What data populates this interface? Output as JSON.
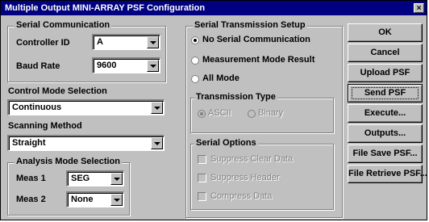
{
  "window": {
    "title": "Multiple Output MINI-ARRAY PSF Configuration",
    "close_glyph": "×"
  },
  "serial_comm": {
    "title": "Serial Communication",
    "controller_id_label": "Controller ID",
    "controller_id_value": "A",
    "baud_rate_label": "Baud Rate",
    "baud_rate_value": "9600"
  },
  "control_mode": {
    "label": "Control Mode Selection",
    "value": "Continuous"
  },
  "scanning": {
    "label": "Scanning Method",
    "value": "Straight"
  },
  "analysis": {
    "title": "Analysis Mode Selection",
    "meas1_label": "Meas 1",
    "meas1_value": "SEG",
    "meas2_label": "Meas 2",
    "meas2_value": "None"
  },
  "serial_tx": {
    "title": "Serial Transmission Setup",
    "options": [
      {
        "label": "No Serial Communication",
        "selected": true
      },
      {
        "label": "Measurement Mode Result",
        "selected": false
      },
      {
        "label": "All Mode",
        "selected": false
      }
    ]
  },
  "tx_type": {
    "title": "Transmission Type",
    "options": [
      {
        "label": "ASCII",
        "selected": true
      },
      {
        "label": "Binary",
        "selected": false
      }
    ]
  },
  "serial_options": {
    "title": "Serial Options",
    "items": [
      {
        "label": "Suppress Clear Data"
      },
      {
        "label": "Suppress Header"
      },
      {
        "label": "Compress Data"
      }
    ]
  },
  "buttons": {
    "ok": "OK",
    "cancel": "Cancel",
    "upload": "Upload PSF",
    "send": "Send PSF",
    "execute": "Execute...",
    "outputs": "Outputs...",
    "file_save": "File Save PSF...",
    "file_retrieve": "File Retrieve PSF..."
  }
}
